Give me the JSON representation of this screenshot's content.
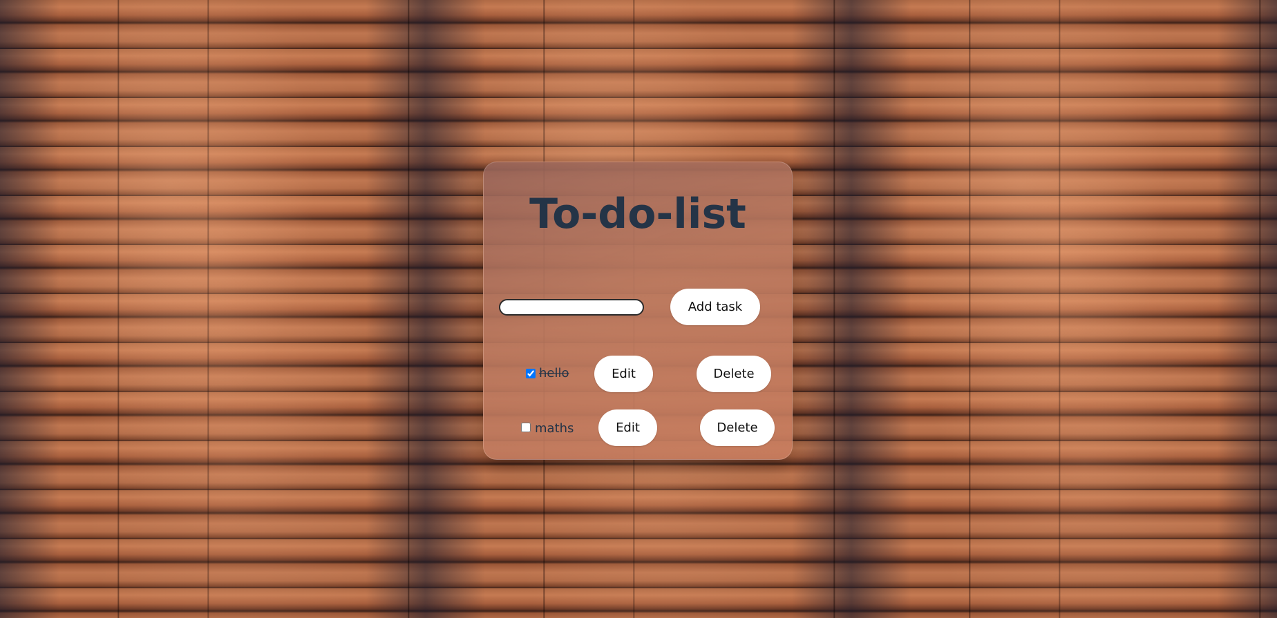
{
  "app": {
    "title": "To-do-list"
  },
  "colors": {
    "title": "#243447",
    "card": "#b87a62",
    "button_bg": "#ffffff"
  },
  "new_task": {
    "value": "",
    "placeholder": "",
    "add_label": "Add task"
  },
  "tasks": [
    {
      "text": "hello",
      "done": true,
      "edit_label": "Edit",
      "delete_label": "Delete"
    },
    {
      "text": "maths",
      "done": false,
      "edit_label": "Edit",
      "delete_label": "Delete"
    }
  ]
}
